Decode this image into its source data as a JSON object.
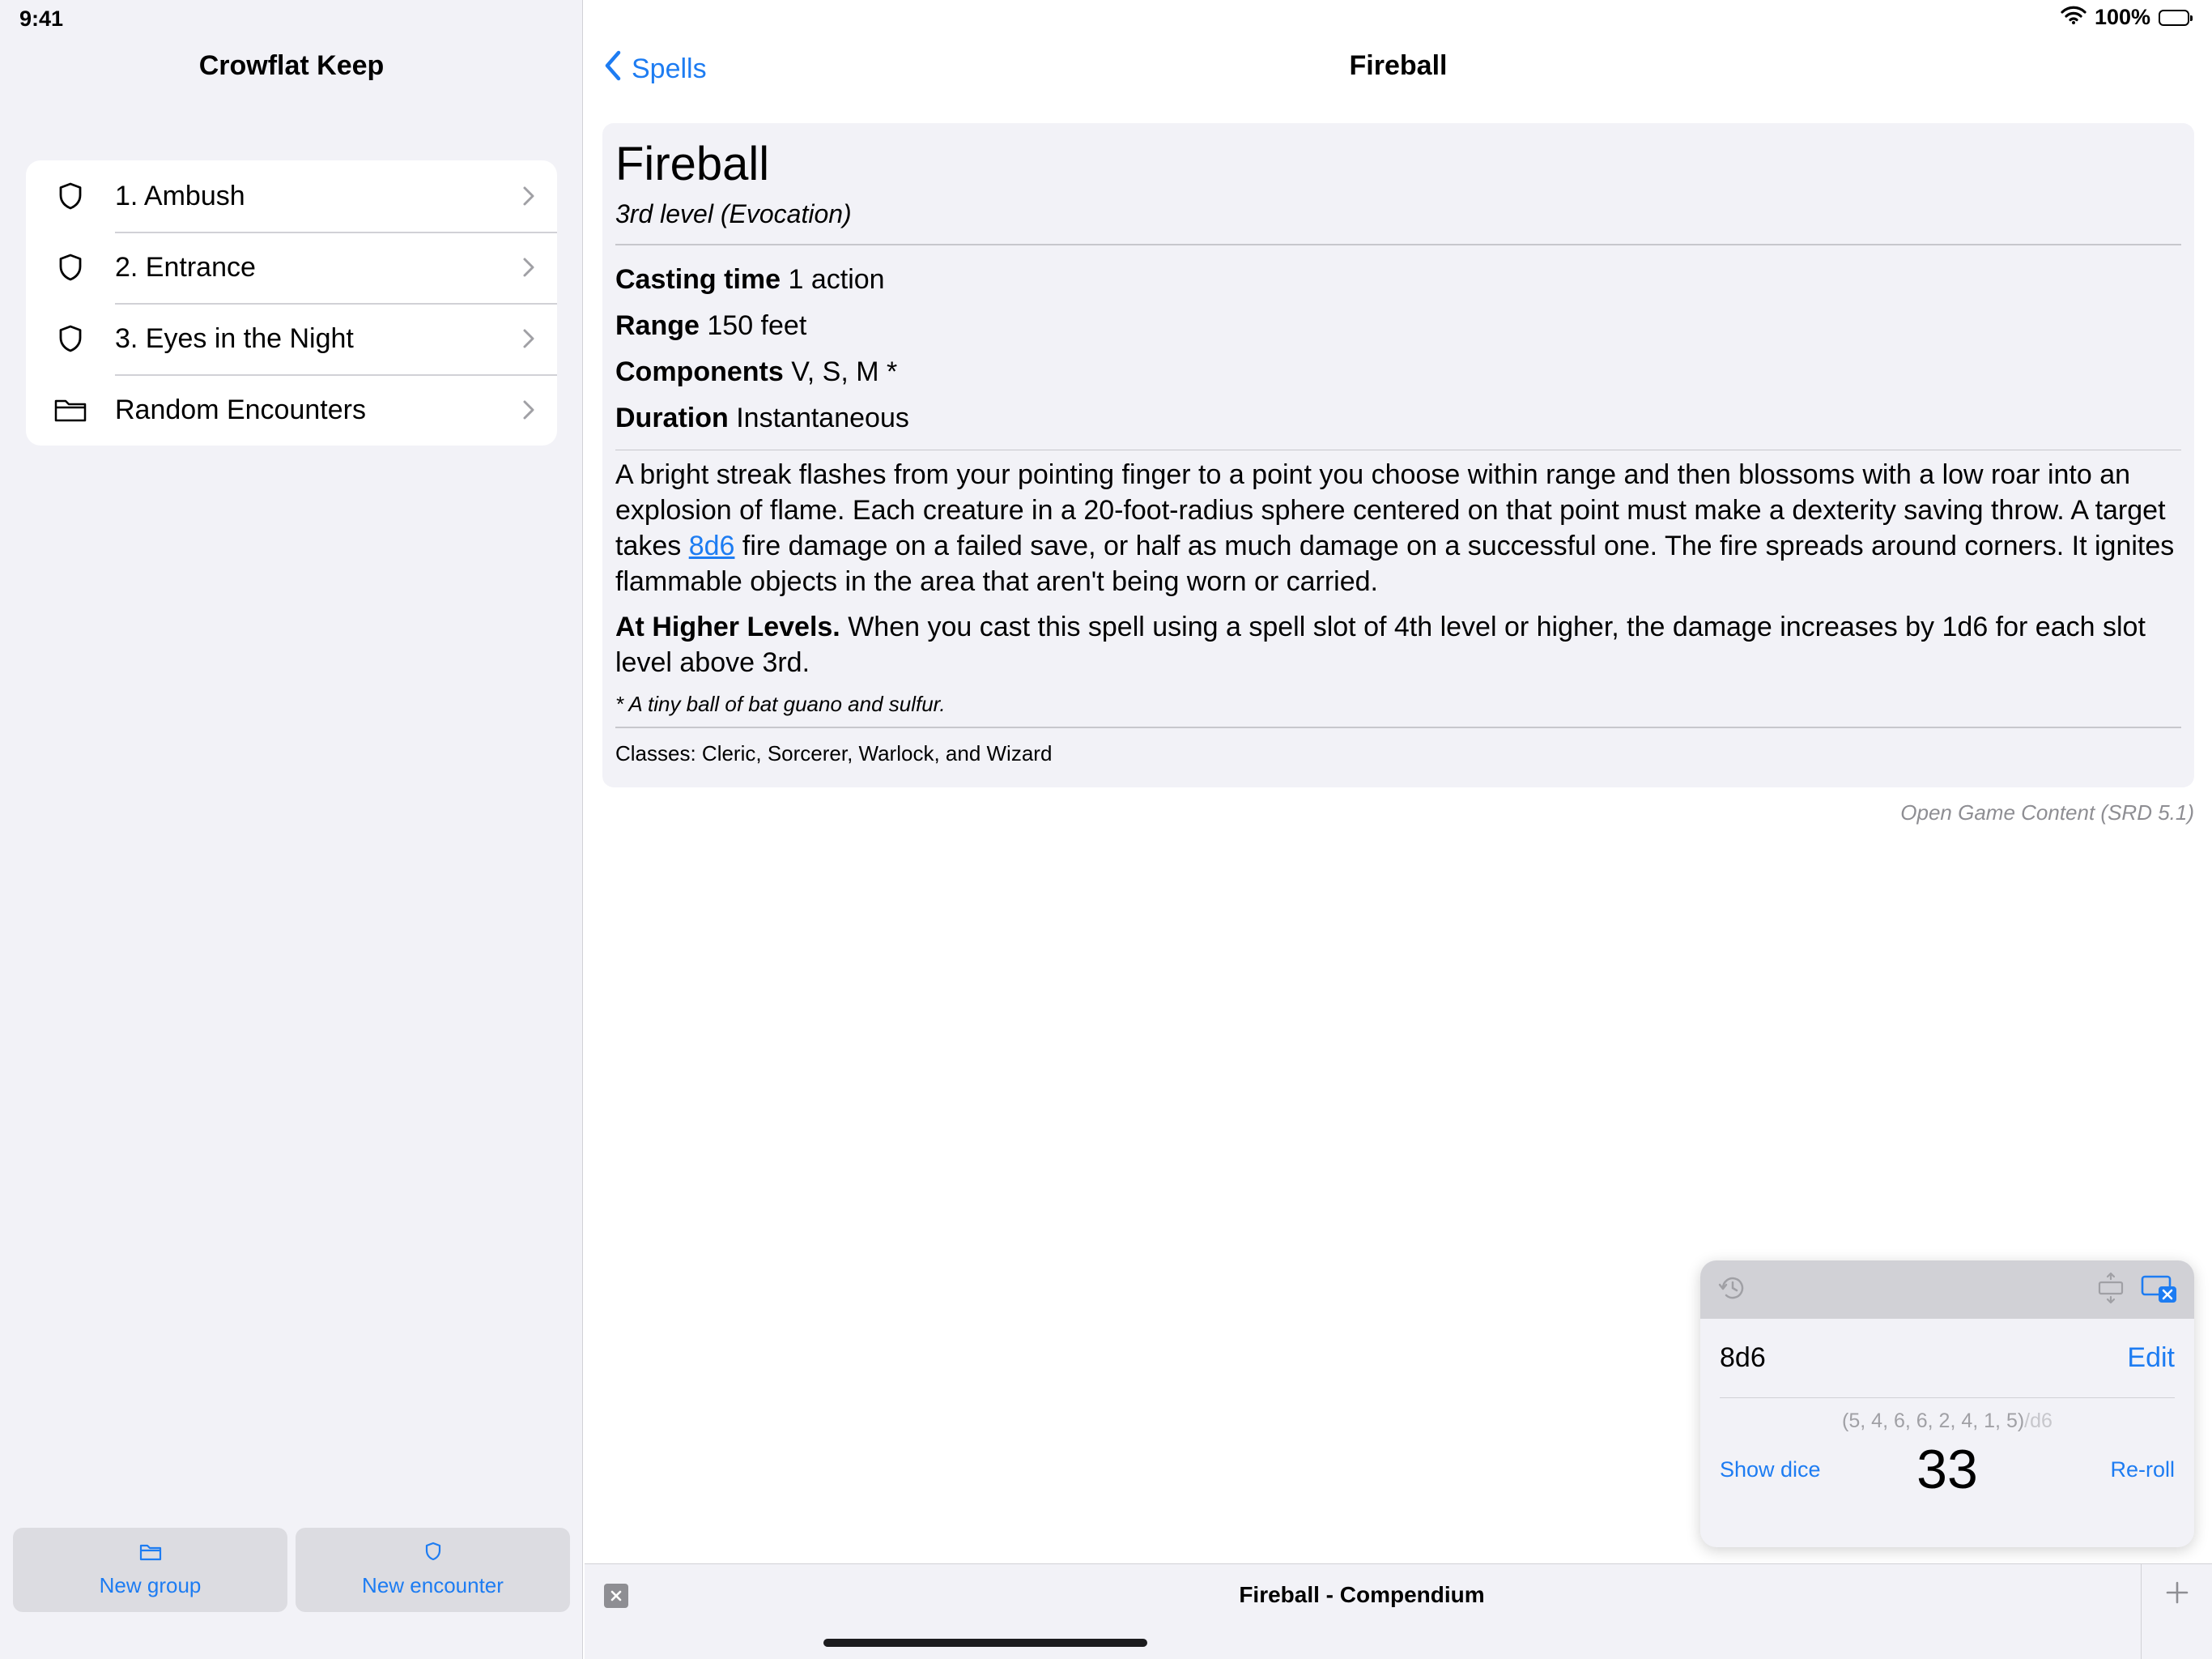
{
  "status_bar": {
    "time": "9:41",
    "battery": "100%"
  },
  "sidebar": {
    "title": "Crowflat Keep",
    "items": [
      {
        "label": "1. Ambush",
        "icon": "shield-icon"
      },
      {
        "label": "2. Entrance",
        "icon": "shield-icon"
      },
      {
        "label": "3. Eyes in the Night",
        "icon": "shield-icon"
      },
      {
        "label": "Random Encounters",
        "icon": "folder-icon"
      }
    ],
    "buttons": {
      "new_group": "New group",
      "new_encounter": "New encounter"
    }
  },
  "nav": {
    "back_label": "Spells",
    "title": "Fireball"
  },
  "spell": {
    "name": "Fireball",
    "level": "3rd level (Evocation)",
    "casting_time_label": "Casting time",
    "casting_time": "1 action",
    "range_label": "Range",
    "range": "150 feet",
    "components_label": "Components",
    "components": "V, S, M *",
    "duration_label": "Duration",
    "duration": "Instantaneous",
    "desc_1": "A bright streak flashes from your pointing finger to a point you choose within range and then blossoms with a low roar into an explosion of flame. Each creature in a 20-foot-radius sphere centered on that point must make a dexterity saving throw. A target takes",
    "desc_link": "8d6",
    "desc_2": "fire damage on a failed save, or half as much damage on a successful one. The fire spreads around corners. It ignites flammable objects in the area that aren't being worn or carried.",
    "higher_label": "At Higher Levels.",
    "higher_text": "When you cast this spell using a spell slot of 4th level or higher, the damage increases by 1d6 for each slot level above 3rd.",
    "footnote": "* A tiny ball of bat guano and sulfur.",
    "classes": "Classes: Cleric, Sorcerer, Warlock, and Wizard",
    "source": "Open Game Content (SRD 5.1)"
  },
  "dice_roller": {
    "expression": "8d6",
    "edit_label": "Edit",
    "rolls": "(5, 4, 6, 6, 2, 4, 1, 5)",
    "rolls_suffix": "/d6",
    "total": "33",
    "show_dice_label": "Show dice",
    "reroll_label": "Re-roll"
  },
  "tab_bar": {
    "title": "Fireball - Compendium"
  },
  "colors": {
    "accent": "#1d7cf2",
    "grouped_bg": "#f2f2f7",
    "separator": "#d1d1d6"
  }
}
